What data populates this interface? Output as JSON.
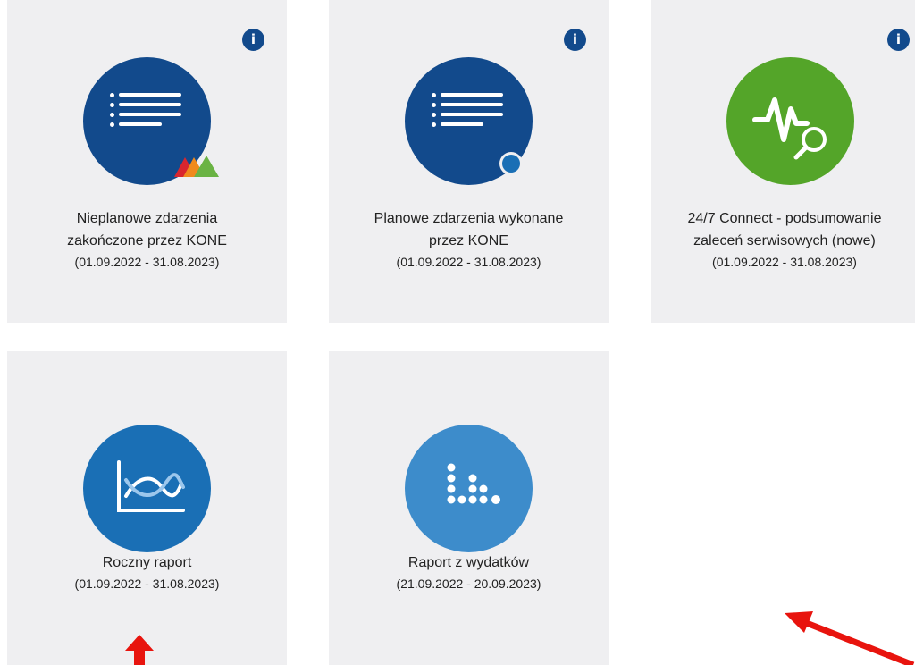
{
  "cards": [
    {
      "title_lines": [
        "Nieplanowe zdarzenia",
        "zakończone przez KONE"
      ],
      "date": "(01.09.2022 - 31.08.2023)",
      "icon": "list-icon",
      "badge": "kone-logo-badge",
      "circle_color": "#124a8c",
      "info": "i"
    },
    {
      "title_lines": [
        "Planowe zdarzenia wykonane",
        "przez KONE"
      ],
      "date": "(01.09.2022 - 31.08.2023)",
      "icon": "list-icon",
      "badge": "blue-dot-badge",
      "circle_color": "#124a8c",
      "info": "i"
    },
    {
      "title_lines": [
        "24/7 Connect - podsumowanie",
        "zaleceń serwisowych (nowe)"
      ],
      "date": "(01.09.2022 - 31.08.2023)",
      "icon": "pulse-search-icon",
      "circle_color": "#54a529",
      "info": "i"
    },
    {
      "title_lines": [
        "Roczny raport"
      ],
      "date": "(01.09.2022 - 31.08.2023)",
      "icon": "line-chart-icon",
      "circle_color": "#1a6fb5"
    },
    {
      "title_lines": [
        "Raport z wydatków"
      ],
      "date": "(21.09.2022 - 20.09.2023)",
      "icon": "dot-chart-icon",
      "circle_color": "#3d8ccb"
    }
  ],
  "annotations": [
    "red-arrow-up",
    "red-arrow-diagonal"
  ]
}
